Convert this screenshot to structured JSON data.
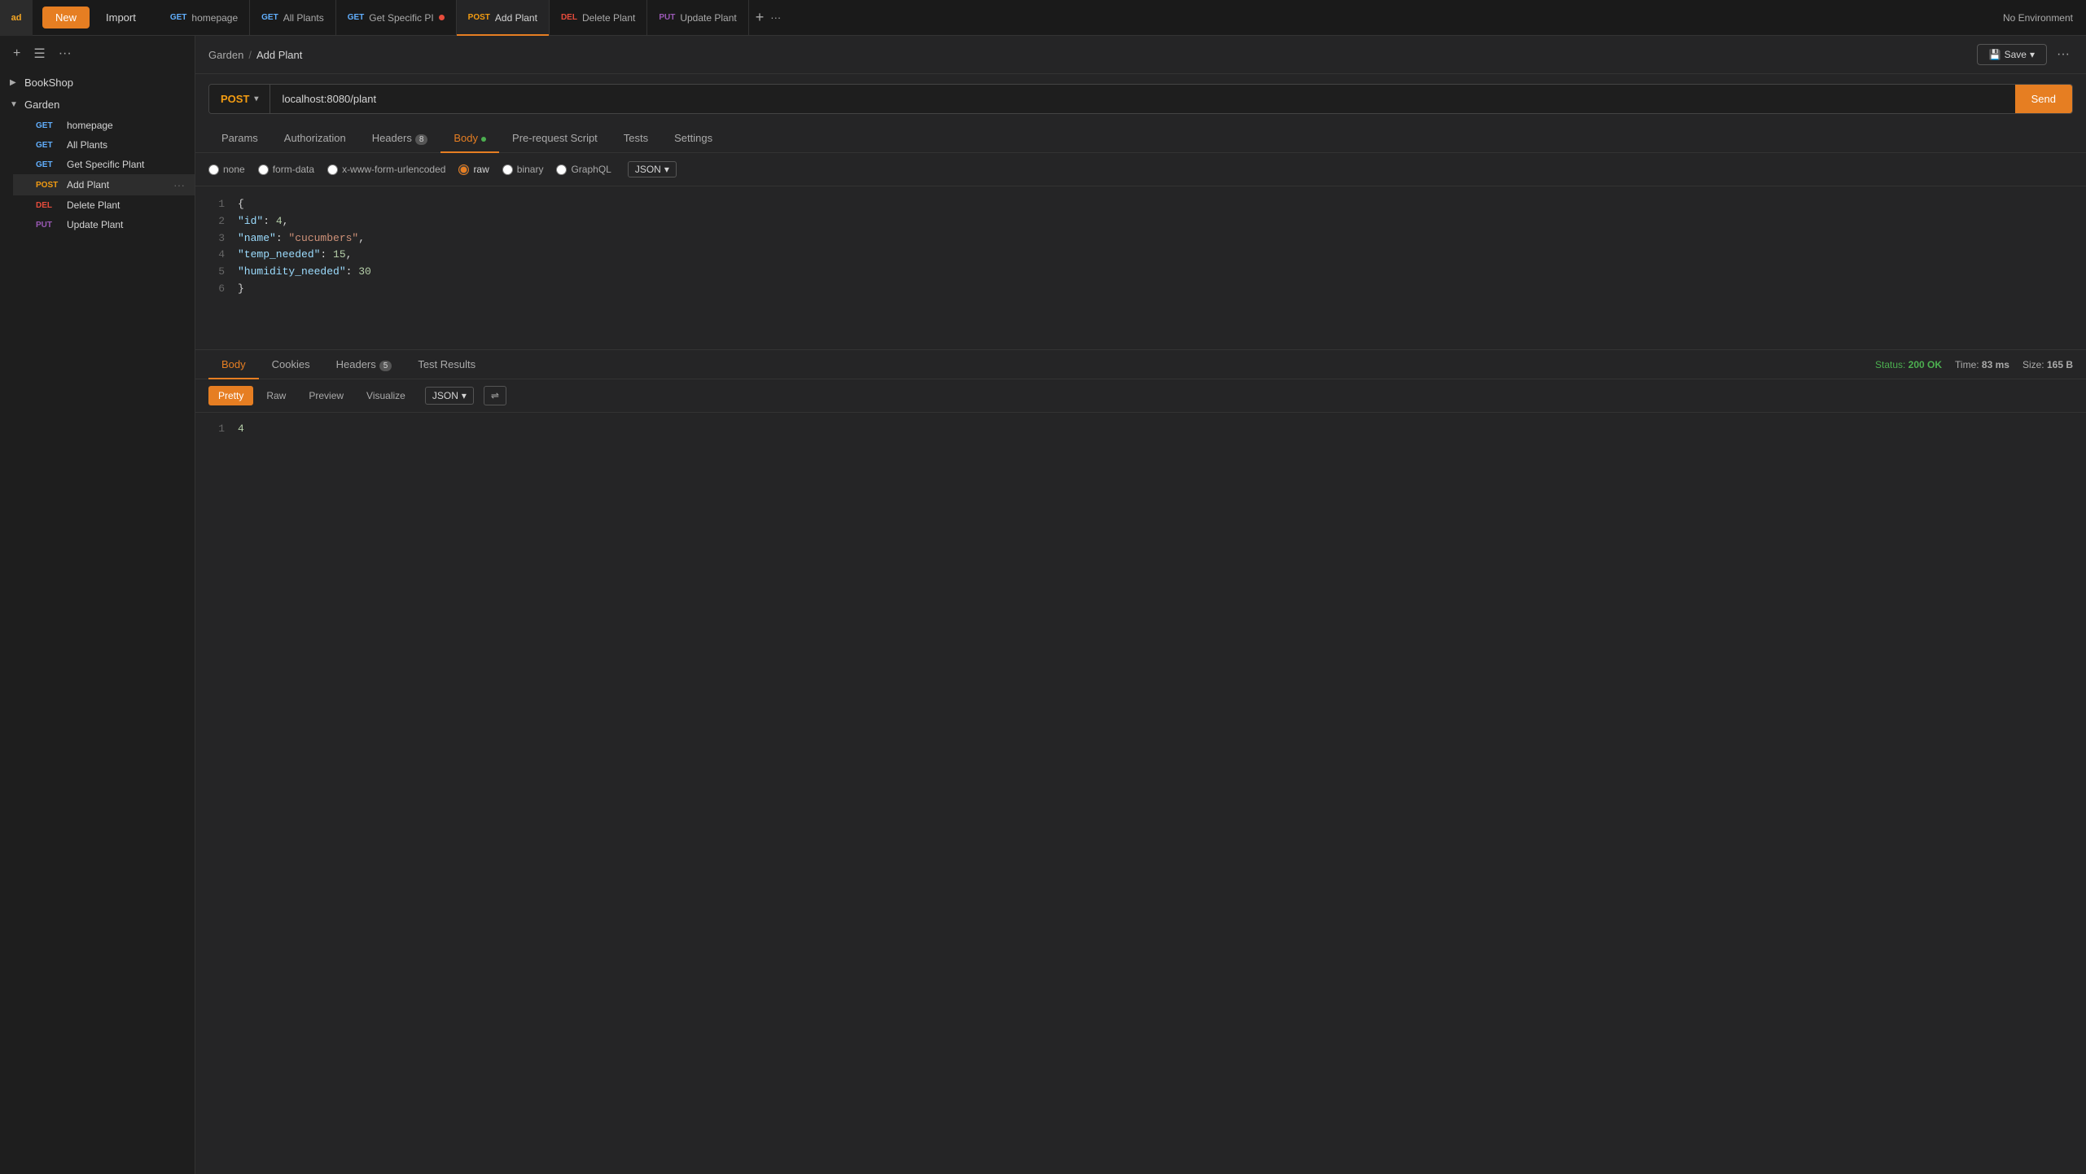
{
  "app": {
    "logo": "ad",
    "new_label": "New",
    "import_label": "Import"
  },
  "tabs": [
    {
      "id": "homepage",
      "method": "GET",
      "name": "homepage",
      "active": false,
      "has_dot": false
    },
    {
      "id": "all-plants",
      "method": "GET",
      "name": "All Plants",
      "active": false,
      "has_dot": false
    },
    {
      "id": "get-specific-pi",
      "method": "GET",
      "name": "Get Specific PI",
      "active": false,
      "has_dot": true
    },
    {
      "id": "add-plant",
      "method": "POST",
      "name": "Add Plant",
      "active": true,
      "has_dot": false
    },
    {
      "id": "delete-plant",
      "method": "DEL",
      "name": "Delete Plant",
      "active": false,
      "has_dot": false
    },
    {
      "id": "update-plant",
      "method": "PUT",
      "name": "Update Plant",
      "active": false,
      "has_dot": false
    }
  ],
  "env_selector": "No Environment",
  "sidebar": {
    "collections": [
      {
        "name": "BookShop",
        "expanded": false,
        "children": []
      },
      {
        "name": "Garden",
        "expanded": true,
        "children": [
          {
            "method": "GET",
            "name": "homepage"
          },
          {
            "method": "GET",
            "name": "All Plants"
          },
          {
            "method": "GET",
            "name": "Get Specific Plant"
          },
          {
            "method": "POST",
            "name": "Add Plant",
            "active": true
          },
          {
            "method": "DEL",
            "name": "Delete Plant"
          },
          {
            "method": "PUT",
            "name": "Update Plant"
          }
        ]
      }
    ]
  },
  "request": {
    "breadcrumb_collection": "Garden",
    "breadcrumb_request": "Add Plant",
    "method": "POST",
    "url": "localhost:8080/plant",
    "tabs": [
      {
        "id": "params",
        "label": "Params",
        "active": false,
        "badge": null
      },
      {
        "id": "authorization",
        "label": "Authorization",
        "active": false,
        "badge": null
      },
      {
        "id": "headers",
        "label": "Headers",
        "active": false,
        "badge": "8"
      },
      {
        "id": "body",
        "label": "Body",
        "active": true,
        "badge": null,
        "dot": true
      },
      {
        "id": "pre-request",
        "label": "Pre-request Script",
        "active": false,
        "badge": null
      },
      {
        "id": "tests",
        "label": "Tests",
        "active": false,
        "badge": null
      },
      {
        "id": "settings",
        "label": "Settings",
        "active": false,
        "badge": null
      }
    ],
    "body_options": [
      {
        "id": "none",
        "label": "none"
      },
      {
        "id": "form-data",
        "label": "form-data"
      },
      {
        "id": "x-www-form-urlencoded",
        "label": "x-www-form-urlencoded"
      },
      {
        "id": "raw",
        "label": "raw",
        "selected": true
      },
      {
        "id": "binary",
        "label": "binary"
      },
      {
        "id": "graphql",
        "label": "GraphQL"
      }
    ],
    "body_format": "JSON",
    "code_lines": [
      {
        "num": "1",
        "content": "{"
      },
      {
        "num": "2",
        "content": "    \"id\": 4,"
      },
      {
        "num": "3",
        "content": "    \"name\": \"cucumbers\","
      },
      {
        "num": "4",
        "content": "    \"temp_needed\": 15,"
      },
      {
        "num": "5",
        "content": "    \"humidity_needed\": 30"
      },
      {
        "num": "6",
        "content": "}"
      }
    ]
  },
  "response": {
    "tabs": [
      {
        "id": "body",
        "label": "Body",
        "active": true
      },
      {
        "id": "cookies",
        "label": "Cookies",
        "active": false
      },
      {
        "id": "headers",
        "label": "Headers",
        "active": false,
        "badge": "5"
      },
      {
        "id": "test-results",
        "label": "Test Results",
        "active": false
      }
    ],
    "status": "200 OK",
    "time": "83 ms",
    "size": "165 B",
    "view_options": [
      "Pretty",
      "Raw",
      "Preview",
      "Visualize"
    ],
    "active_view": "Pretty",
    "format": "JSON",
    "response_lines": [
      {
        "num": "1",
        "content": "4"
      }
    ]
  },
  "save_label": "Save"
}
